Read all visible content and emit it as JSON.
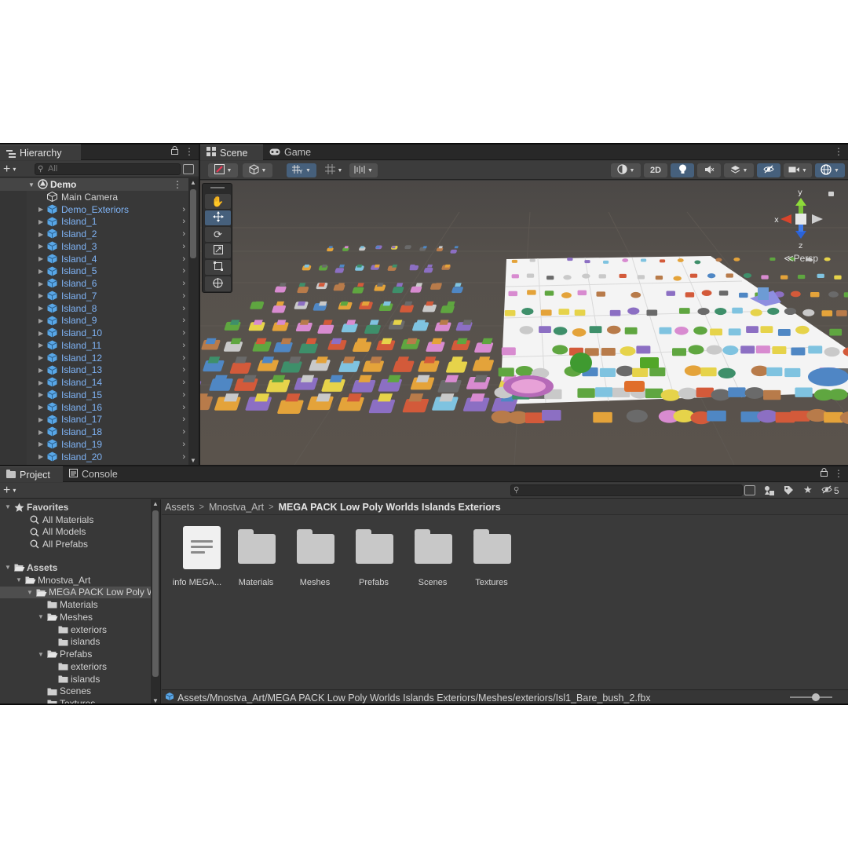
{
  "hierarchy": {
    "tab": "Hierarchy",
    "search_placeholder": "All",
    "scene_name": "Demo",
    "items": [
      {
        "label": "Main Camera",
        "kind": "camera"
      },
      {
        "label": "Demo_Exteriors",
        "kind": "prefab"
      },
      {
        "label": "Island_1",
        "kind": "prefab"
      },
      {
        "label": "Island_2",
        "kind": "prefab"
      },
      {
        "label": "Island_3",
        "kind": "prefab"
      },
      {
        "label": "Island_4",
        "kind": "prefab"
      },
      {
        "label": "Island_5",
        "kind": "prefab"
      },
      {
        "label": "Island_6",
        "kind": "prefab"
      },
      {
        "label": "Island_7",
        "kind": "prefab"
      },
      {
        "label": "Island_8",
        "kind": "prefab"
      },
      {
        "label": "Island_9",
        "kind": "prefab"
      },
      {
        "label": "Island_10",
        "kind": "prefab"
      },
      {
        "label": "Island_11",
        "kind": "prefab"
      },
      {
        "label": "Island_12",
        "kind": "prefab"
      },
      {
        "label": "Island_13",
        "kind": "prefab"
      },
      {
        "label": "Island_14",
        "kind": "prefab"
      },
      {
        "label": "Island_15",
        "kind": "prefab"
      },
      {
        "label": "Island_16",
        "kind": "prefab"
      },
      {
        "label": "Island_17",
        "kind": "prefab"
      },
      {
        "label": "Island_18",
        "kind": "prefab"
      },
      {
        "label": "Island_19",
        "kind": "prefab"
      },
      {
        "label": "Island_20",
        "kind": "prefab"
      }
    ]
  },
  "scene": {
    "tabs": [
      "Scene",
      "Game"
    ],
    "toolbar": {
      "mode_2d": "2D"
    },
    "gizmo": {
      "y": "y",
      "x": "x",
      "z": "z",
      "projection": "Persp"
    },
    "tools": [
      "hand-tool",
      "move-tool",
      "rotate-tool",
      "scale-tool",
      "rect-tool",
      "transform-tool"
    ],
    "active_tool": "move-tool"
  },
  "project": {
    "tabs": [
      "Project",
      "Console"
    ],
    "hidden_count": "5",
    "tree": [
      {
        "label": "Favorites",
        "depth": 0,
        "kind": "star",
        "open": true
      },
      {
        "label": "All Materials",
        "depth": 1,
        "kind": "search"
      },
      {
        "label": "All Models",
        "depth": 1,
        "kind": "search"
      },
      {
        "label": "All Prefabs",
        "depth": 1,
        "kind": "search"
      },
      {
        "label": "Assets",
        "depth": 0,
        "kind": "folder-open",
        "open": true
      },
      {
        "label": "Mnostva_Art",
        "depth": 1,
        "kind": "folder-open",
        "open": true
      },
      {
        "label": "MEGA PACK Low Poly Worlds Islands Exteriors",
        "depth": 2,
        "kind": "folder-open",
        "open": true,
        "selected": true
      },
      {
        "label": "Materials",
        "depth": 3,
        "kind": "folder"
      },
      {
        "label": "Meshes",
        "depth": 3,
        "kind": "folder-open",
        "open": true
      },
      {
        "label": "exteriors",
        "depth": 4,
        "kind": "folder"
      },
      {
        "label": "islands",
        "depth": 4,
        "kind": "folder"
      },
      {
        "label": "Prefabs",
        "depth": 3,
        "kind": "folder-open",
        "open": true
      },
      {
        "label": "exteriors",
        "depth": 4,
        "kind": "folder"
      },
      {
        "label": "islands",
        "depth": 4,
        "kind": "folder"
      },
      {
        "label": "Scenes",
        "depth": 3,
        "kind": "folder"
      },
      {
        "label": "Textures",
        "depth": 3,
        "kind": "folder"
      }
    ],
    "breadcrumbs": [
      "Assets",
      "Mnostva_Art",
      "MEGA PACK Low Poly Worlds Islands Exteriors"
    ],
    "assets": [
      {
        "label": "info MEGA...",
        "kind": "document"
      },
      {
        "label": "Materials",
        "kind": "folder"
      },
      {
        "label": "Meshes",
        "kind": "folder"
      },
      {
        "label": "Prefabs",
        "kind": "folder"
      },
      {
        "label": "Scenes",
        "kind": "folder"
      },
      {
        "label": "Textures",
        "kind": "folder"
      }
    ],
    "status_path": "Assets/Mnostva_Art/MEGA PACK Low Poly Worlds Islands Exteriors/Meshes/exteriors/Isl1_Bare_bush_2.fbx",
    "zoom_level": 0.6
  }
}
